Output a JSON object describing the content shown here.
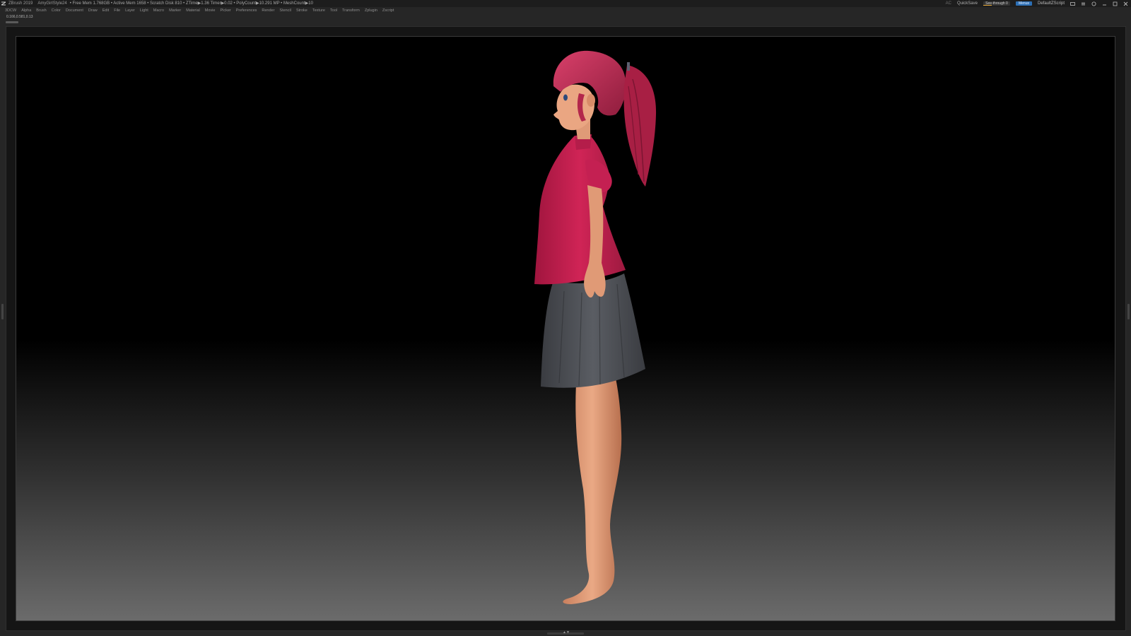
{
  "titlebar": {
    "app_title": "ZBrush 2019",
    "document": "AmyGirlStyle24",
    "stats": "• Free Mem 1.768GB • Active Mem 1658 • Scratch Disk 810 • ZTime▶1.36 Timer▶0.02 • PolyCount▶10.291 MP • MeshCount▶10",
    "ac_label": "AC",
    "quicksave_label": "QuickSave",
    "see_through_label": "See-through",
    "see_through_value": "0",
    "menus_chip": "Menus",
    "script_label": "DefaultZScript"
  },
  "menubar": {
    "items": [
      "3DCW",
      "Alpha",
      "Brush",
      "Color",
      "Document",
      "Draw",
      "Edit",
      "File",
      "Layer",
      "Light",
      "Macro",
      "Marker",
      "Material",
      "Movie",
      "Picker",
      "Preferences",
      "Render",
      "Stencil",
      "Stroke",
      "Texture",
      "Tool",
      "Transform",
      "Zplugin",
      "Zscript"
    ]
  },
  "coordinates": "0.166,0.581,0.13",
  "colors": {
    "accent": "#2c6fb5",
    "shirt": "#c11d4f",
    "hair": "#b8284d",
    "skin": "#e9a27c",
    "skirt": "#4a4c52"
  },
  "icons": [
    "zbrush-logo-icon",
    "layout-icon",
    "menu-icon",
    "help-icon",
    "minimize-icon",
    "maximize-icon",
    "close-icon"
  ]
}
